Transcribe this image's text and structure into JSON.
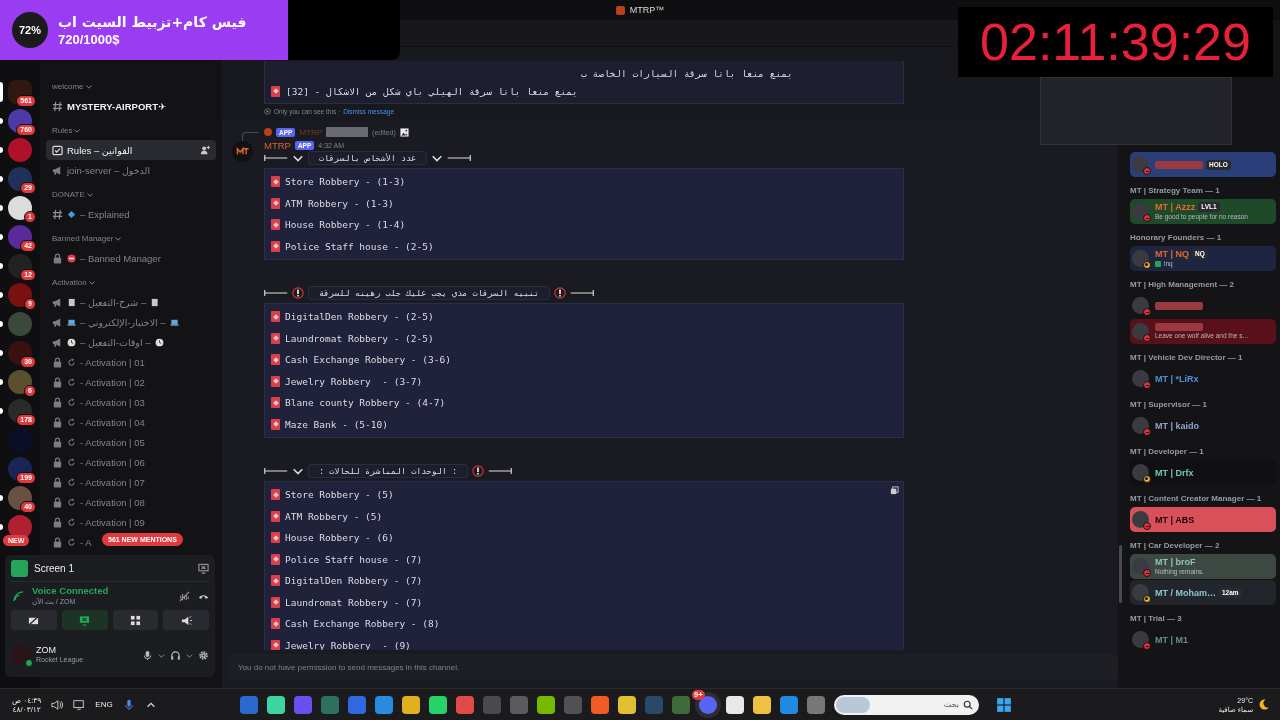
{
  "goal_overlay": {
    "percent": "72%",
    "title": "فيس كام+تزبيط السيت اب",
    "amount": "720/1000$",
    "level": 0.72
  },
  "timer": "02:11:39:29",
  "window": {
    "title": "MTRP™"
  },
  "servers": [
    {
      "badge": "561",
      "selected": true,
      "unread": false
    },
    {
      "badge": "760",
      "selected": false,
      "unread": true
    },
    {
      "selected": false,
      "unread": true
    },
    {
      "badge": "29",
      "selected": false,
      "unread": true
    },
    {
      "badge": "1",
      "selected": false,
      "unread": true
    },
    {
      "badge": "42",
      "selected": false,
      "unread": true
    },
    {
      "badge": "12",
      "selected": false,
      "unread": true
    },
    {
      "badge": "9",
      "selected": false,
      "unread": true
    },
    {
      "selected": false,
      "unread": true
    },
    {
      "badge": "30",
      "selected": false,
      "unread": true
    },
    {
      "badge": "6",
      "selected": false,
      "unread": true
    },
    {
      "badge": "178",
      "selected": false,
      "unread": true
    },
    {
      "selected": false,
      "unread": false
    },
    {
      "badge": "199",
      "selected": false,
      "unread": false
    },
    {
      "badge": "40",
      "selected": false,
      "unread": true
    },
    {
      "selected": false,
      "unread": true
    }
  ],
  "new_pill": "NEW",
  "channel_groups": [
    {
      "name": "welcome",
      "channels": [
        {
          "kind": "text",
          "name": "MYSTERY-AIRPORT✈",
          "selected": false,
          "unread": true
        }
      ]
    },
    {
      "name": "Rules",
      "channels": [
        {
          "kind": "rules",
          "name": "Rules – القوانين",
          "selected": true,
          "unread": true
        },
        {
          "kind": "announce",
          "name": "join-server – الدخول",
          "selected": false,
          "unread": false
        }
      ]
    },
    {
      "name": "DONATE",
      "channels": [
        {
          "kind": "text",
          "emoji": {
            "kind": "diamond"
          },
          "name": "– Explained",
          "selected": false,
          "unread": false
        }
      ]
    },
    {
      "name": "Banned Manager",
      "channels": [
        {
          "kind": "locked",
          "emoji": {
            "kind": "no-entry"
          },
          "name": "– Banned Manager",
          "selected": false,
          "unread": false
        }
      ]
    },
    {
      "name": "Activation",
      "channels": [
        {
          "kind": "announce",
          "emoji": {
            "kind": "page"
          },
          "name": "– شرح-التفعيل –",
          "emoji_after": {
            "kind": "page"
          },
          "selected": false,
          "unread": false
        },
        {
          "kind": "announce",
          "emoji": {
            "kind": "laptop"
          },
          "name": "– الاختبار-الإلكتروني –",
          "emoji_after": {
            "kind": "laptop"
          },
          "selected": false,
          "unread": false
        },
        {
          "kind": "announce",
          "emoji": {
            "kind": "clock"
          },
          "name": "– اوقات-التفعيل –",
          "emoji_after": {
            "kind": "clock"
          },
          "selected": false,
          "unread": false
        },
        {
          "kind": "locked",
          "emoji": {
            "kind": "reload"
          },
          "name": "- Activation | 01",
          "selected": false,
          "unread": false
        },
        {
          "kind": "locked",
          "emoji": {
            "kind": "reload"
          },
          "name": "- Activation | 02",
          "selected": false,
          "unread": false
        },
        {
          "kind": "locked",
          "emoji": {
            "kind": "reload"
          },
          "name": "- Activation | 03",
          "selected": false,
          "unread": false
        },
        {
          "kind": "locked",
          "emoji": {
            "kind": "reload"
          },
          "name": "- Activation | 04",
          "selected": false,
          "unread": false
        },
        {
          "kind": "locked",
          "emoji": {
            "kind": "reload"
          },
          "name": "- Activation | 05",
          "selected": false,
          "unread": false
        },
        {
          "kind": "locked",
          "emoji": {
            "kind": "reload"
          },
          "name": "- Activation | 06",
          "selected": false,
          "unread": false
        },
        {
          "kind": "locked",
          "emoji": {
            "kind": "reload"
          },
          "name": "- Activation | 07",
          "selected": false,
          "unread": false
        },
        {
          "kind": "locked",
          "emoji": {
            "kind": "reload"
          },
          "name": "- Activation | 08",
          "selected": false,
          "unread": false
        },
        {
          "kind": "locked",
          "emoji": {
            "kind": "reload"
          },
          "name": "- Activation | 09",
          "selected": false,
          "unread": false
        },
        {
          "kind": "locked",
          "emoji": {
            "kind": "reload"
          },
          "name": "- A",
          "selected": false,
          "unread": false
        }
      ]
    }
  ],
  "mentions_pill": "561 NEW MENTIONS",
  "voice": {
    "screen": "Screen 1",
    "status": "Voice Connected",
    "channel": "بث الآن / ZOM"
  },
  "user": {
    "name": "ZOM",
    "activity": "Rocket League"
  },
  "notice": {
    "lines": [
      {
        "text": "يمنع منعا باتا سرقة السيارات الخاصة ب",
        "icon": false
      },
      {
        "text": "[32] - يمنع منعا باتا سرقة الهيلي باي شكل من الاشكال",
        "icon": true
      }
    ],
    "ephemeral": "Only you can see this ·",
    "dismiss": "Dismiss message"
  },
  "message": {
    "reply": {
      "tag": "APP",
      "author": "MTRP",
      "edited": "(edited)"
    },
    "author": "MTRP",
    "tag": "APP",
    "time": "4:32 AM",
    "sections": [
      {
        "title": "عدد الأشخاص بالسرقات",
        "left_icon": {
          "kind": "chevron"
        },
        "right_icon": {
          "kind": "chevron"
        },
        "items": [
          "Store Robbery - (1-3)",
          "ATM Robbery - (1-3)",
          "House Robbery - (1-4)",
          "Police Staff house - (2-5)"
        ]
      },
      {
        "title": "تنبيه السرقات مذي يجب عليك جلب رهينه للسرقة",
        "left_icon": {
          "kind": "alert"
        },
        "right_icon": {
          "kind": "alert"
        },
        "items": [
          "DigitalDen Robbery - (2-5)",
          "Laundromat Robbery - (2-5)",
          "Cash Exchange Robbery - (3-6)",
          "Jewelry Robbery  - (3-7)",
          "Blane county Robbery - (4-7)",
          "Maze Bank - (5-10)"
        ]
      },
      {
        "title": ": الوحدات المباشرة للحالات :",
        "left_icon": {
          "kind": "chevron"
        },
        "right_icon": {
          "kind": "alert"
        },
        "items": [
          "Store Robbery - (5)",
          "ATM Robbery - (5)",
          "House Robbery - (6)",
          "Police Staff house - (7)",
          "DigitalDen Robbery - (7)",
          "Laundromat Robbery - (7)",
          "Cash Exchange Robbery - (8)",
          "Jewelry Robbery  - (9)"
        ]
      }
    ]
  },
  "input_placeholder": "You do not have permission to send messages in this channel.",
  "member_groups": [
    {
      "members": [
        {
          "tag": "HOLO",
          "status": {
            "kind": "dnd"
          },
          "banner": {
            "color": "#2a3f7a"
          }
        }
      ]
    },
    {
      "title": "MT | Strategy Team — 1",
      "members": [
        {
          "name": "MT | Azzz",
          "color": "#e2682c",
          "tag": "LVL1",
          "status_text": "Be good to people for no reason",
          "status": {
            "kind": "dnd"
          },
          "banner": {
            "color": "#1f4a2a"
          }
        }
      ]
    },
    {
      "title": "Honorary Founders — 1",
      "members": [
        {
          "name": "MT | NQ",
          "color": "#e2682c",
          "tag": "NQ",
          "activity": "inq",
          "status": {
            "kind": "idle"
          },
          "banner": {
            "color": "#1e2540"
          }
        }
      ]
    },
    {
      "title": "MT | High Management — 2",
      "members": [
        {
          "status": {
            "kind": "dnd"
          }
        },
        {
          "status_text": "Leave one wolf alive and the s…",
          "status": {
            "kind": "dnd"
          },
          "banner": {
            "color": "#5a1018"
          }
        }
      ]
    },
    {
      "title": "MT | Vehicle Dev Director — 1",
      "members": [
        {
          "name": "MT | *LiRx",
          "color": "#4a90d9",
          "status": {
            "kind": "dnd"
          }
        }
      ]
    },
    {
      "title": "MT | Supervisor — 1",
      "members": [
        {
          "name": "MT | kaido",
          "color": "#8ea3c9",
          "status": {
            "kind": "dnd"
          }
        }
      ]
    },
    {
      "title": "MT | Developer — 1",
      "members": [
        {
          "name": "MT | Drfx",
          "color": "#6cc7b9",
          "status": {
            "kind": "idle"
          },
          "banner": {
            "color": "#101012"
          }
        }
      ]
    },
    {
      "title": "MT | Content Creator Manager — 1",
      "members": [
        {
          "name": "MT | ABS",
          "color": "#1a0505",
          "status": {
            "kind": "dnd"
          },
          "banner": {
            "color": "#d8505a"
          }
        }
      ]
    },
    {
      "title": "MT | Car Developer — 2",
      "members": [
        {
          "name": "MT | broF",
          "color": "#8fc2b8",
          "status_text": "Nothing remains.",
          "status": {
            "kind": "dnd"
          },
          "banner": {
            "color": "#3e4843"
          }
        },
        {
          "name": "MT / Moham…",
          "color": "#8fc2d0",
          "tag": "12am",
          "status": {
            "kind": "idle"
          },
          "banner": {
            "color": "#22252c"
          }
        }
      ]
    },
    {
      "title": "MT | Trial — 3",
      "members": [
        {
          "name": "MT | M1",
          "color": "#5f8f8c",
          "status": {
            "kind": "dnd"
          }
        }
      ]
    }
  ],
  "taskbar": {
    "time": "٠٤:٣٩ ص",
    "date": "٤٨/٠٣/١٢",
    "lang": "ENG",
    "chat_badge": "9+",
    "search_placeholder": "بحث",
    "temp": "29°C",
    "weather": "سماء صافية"
  }
}
